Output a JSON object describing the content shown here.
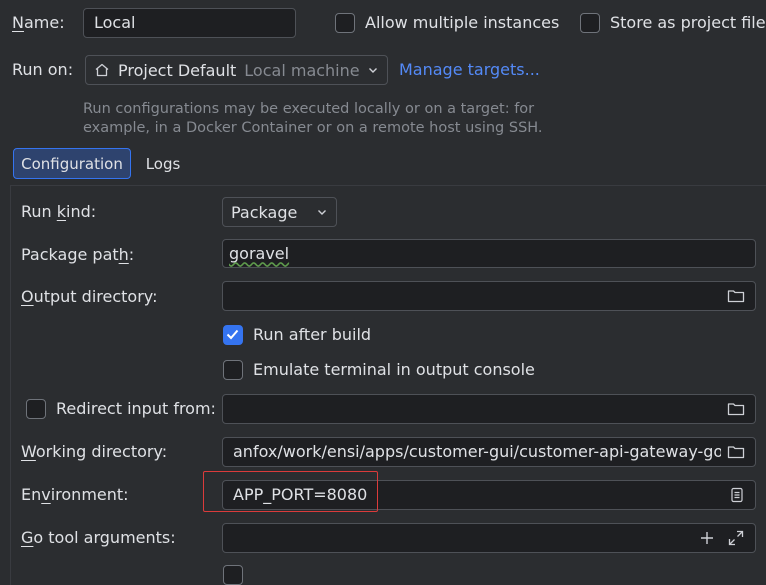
{
  "header": {
    "name_label": "Name:",
    "name_value": "Local",
    "allow_multiple_label": "Allow multiple instances",
    "store_as_project_label": "Store as project file"
  },
  "run_on": {
    "label": "Run on:",
    "target_name": "Project Default",
    "target_type": "Local machine",
    "manage_targets": "Manage targets...",
    "hint_line1": "Run configurations may be executed locally or on a target: for",
    "hint_line2": "example, in a Docker Container or on a remote host using SSH."
  },
  "tabs": [
    {
      "label": "Configuration",
      "active": true
    },
    {
      "label": "Logs",
      "active": false
    }
  ],
  "form": {
    "run_kind_label": "Run kind:",
    "run_kind_value": "Package",
    "package_path_label": "Package path:",
    "package_path_value": "goravel",
    "output_dir_label": "Output directory:",
    "output_dir_value": "",
    "run_after_build_label": "Run after build",
    "run_after_build_checked": true,
    "emulate_terminal_label": "Emulate terminal in output console",
    "emulate_terminal_checked": false,
    "redirect_input_label": "Redirect input from:",
    "redirect_input_checked": false,
    "redirect_input_value": "",
    "working_dir_label": "Working directory:",
    "working_dir_value": "anfox/work/ensi/apps/customer-gui/customer-api-gateway-go",
    "environment_label": "Environment:",
    "environment_value": "APP_PORT=8080",
    "go_tool_args_label": "Go tool arguments:",
    "go_tool_args_value": ""
  },
  "colors": {
    "background": "#2b2d30",
    "field_bg": "#1e1f22",
    "accent": "#3574f0",
    "link": "#548af7",
    "highlight_box": "#db3b3b"
  },
  "icons": [
    "home-icon",
    "chevron-down-icon",
    "folder-icon",
    "checkmark-icon",
    "document-icon",
    "plus-icon",
    "expand-icon"
  ]
}
